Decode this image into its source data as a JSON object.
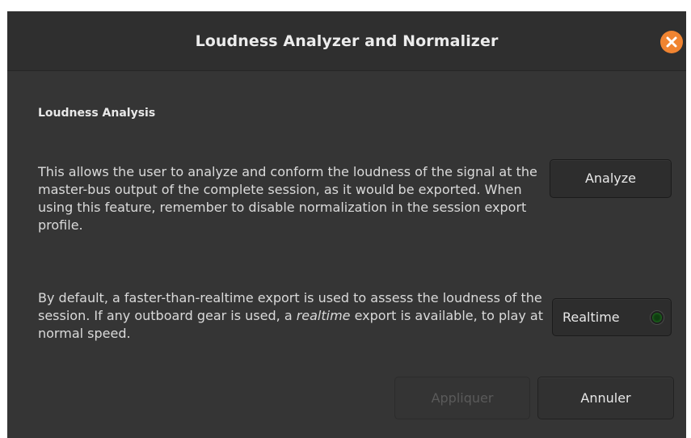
{
  "window": {
    "title": "Loudness Analyzer and Normalizer",
    "close_icon": "close-icon"
  },
  "section": {
    "title": "Loudness Analysis",
    "paragraph1": "This allows the user to analyze and conform the loudness of the signal at the master-bus output of the complete session, as it would be exported. When using this feature, remember to disable normalization in the session export profile.",
    "paragraph2_before": "By default, a faster-than-realtime export is used to assess the loudness of the session. If any outboard gear is used, a ",
    "paragraph2_emphasis": "realtime",
    "paragraph2_after": " export is available, to play at normal speed."
  },
  "buttons": {
    "analyze_label": "Analyze",
    "realtime_label": "Realtime",
    "realtime_active": false,
    "apply_label": "Appliquer",
    "apply_enabled": false,
    "cancel_label": "Annuler"
  },
  "colors": {
    "dialog_bg": "#353535",
    "titlebar_bg": "#2f2f2f",
    "close_button": "#f08431",
    "led_off": "#0f3d10"
  }
}
